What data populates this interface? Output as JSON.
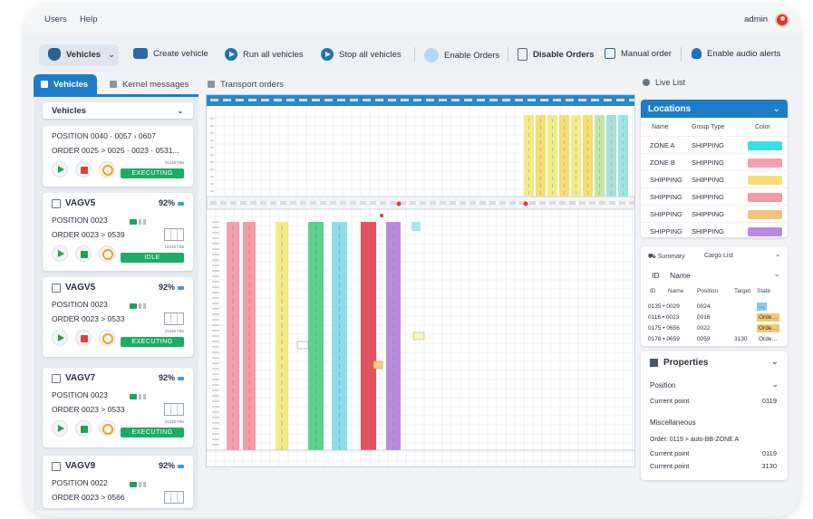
{
  "menu": {
    "users": "Users",
    "help": "Help",
    "admin": "admin"
  },
  "toolbar": {
    "vehicles": "Vehicles",
    "create_vehicle": "Create vehicle",
    "run_all": "Run all vehicles",
    "stop_all": "Stop all vehicles",
    "enable_orders": "Enable Orders",
    "disable_orders": "Disable Orders",
    "manual_order": "Manual order",
    "audio_alerts": "Enable audio alerts"
  },
  "tabs": {
    "vehicles": "Vehicles",
    "kernel": "Kernel messages",
    "transport": "Transport orders",
    "live": "Live List"
  },
  "vehicles_select": "Vehicles",
  "cards": [
    {
      "name": "",
      "pct": "",
      "position": "POSITION  0040 · 0057   ›   0607",
      "order": "ORDER  0025 > 0025 · 0023 · 0531...",
      "tag": "10249 F86",
      "status": "EXECUTING",
      "stop_red": true,
      "show_battery": false
    },
    {
      "name": "VAGV5",
      "pct": "92%",
      "position": "POSITION  0023",
      "order": "ORDER  0023 > 0539",
      "tag": "10249 F86",
      "status": "IDLE",
      "stop_red": false,
      "show_battery": true
    },
    {
      "name": "VAGV5",
      "pct": "92%",
      "position": "POSITION  0023",
      "order": "ORDER  0023 > 0533",
      "tag": "10249 F86",
      "status": "EXECUTING",
      "stop_red": true,
      "show_battery": true
    },
    {
      "name": "VAGV7",
      "pct": "92%",
      "position": "POSITION  0023",
      "order": "ORDER  0023 > 0533",
      "tag": "10249 F86",
      "status": "EXECUTING",
      "stop_red": false,
      "show_battery": true
    },
    {
      "name": "VAGV9",
      "pct": "92%",
      "position": "POSITION  0022",
      "order": "ORDER  0023 > 0566",
      "tag": "",
      "status": "",
      "stop_red": false,
      "show_battery": true
    }
  ],
  "locations": {
    "title": "Locations",
    "col_name": "Name",
    "col_group": "Group Type",
    "col_color": "Color",
    "rows": [
      {
        "name": "ZONE A",
        "group": "SHIPPING",
        "color": "#35dfe3"
      },
      {
        "name": "ZONE B",
        "group": "SHIPPING",
        "color": "#f2a0ae"
      },
      {
        "name": "SHIPPING",
        "group": "SHIPPING",
        "color": "#f7df72"
      },
      {
        "name": "SHIPPING",
        "group": "SHIPPING",
        "color": "#f29aa6"
      },
      {
        "name": "SHIPPING",
        "group": "SHIPPING",
        "color": "#f5c27a"
      },
      {
        "name": "SHIPPING",
        "group": "SHIPPING",
        "color": "#b88be0"
      }
    ]
  },
  "cargo": {
    "summary": "Summary",
    "list": "Cargo List",
    "filter_id": "ID",
    "filter_name": "Name",
    "cols": [
      "ID",
      "Name",
      "Position",
      "Target",
      "State"
    ],
    "rows": [
      {
        "name": "0135 • 0029",
        "position": "0024",
        "target": "",
        "state": "…",
        "state_color": "#8ac8f0"
      },
      {
        "name": "0116 • 0023",
        "position": "0016",
        "target": "",
        "state": "Orde…",
        "state_color": "#f5c96e"
      },
      {
        "name": "0175 • 0656",
        "position": "0022",
        "target": "",
        "state": "Orde…",
        "state_color": "#f5c96e"
      },
      {
        "name": "0178 • 0659",
        "position": "0059",
        "target": "3130",
        "state": "Orde…",
        "state_color": ""
      }
    ]
  },
  "properties": {
    "title": "Properties",
    "position_label": "Position",
    "current_point_label": "Current point",
    "current_point": "0119",
    "misc_label": "Miscellaneous",
    "order_line": "Order:  0119  >  auto-BB-ZONE A",
    "cp2_label": "Current point",
    "cp2": "0119",
    "cp3_label": "Current point",
    "cp3": "3130"
  },
  "map": {
    "aisles_top": [
      "#f4ea86",
      "#f7df72",
      "#f4ea86",
      "#f7df72",
      "#f4ea86",
      "#f7df72",
      "#bfe8a8",
      "#a8e0d8",
      "#9ee2e6"
    ],
    "aisles_bottom": [
      "#f2a0ae",
      "#f29aa6",
      "#f4ea86",
      "#5fcf8a",
      "#8fdde8",
      "#e85060",
      "#b88be0"
    ],
    "marker_color": "#e23c3c"
  }
}
